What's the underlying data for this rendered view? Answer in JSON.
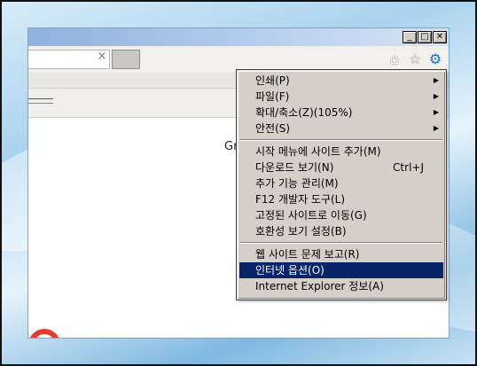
{
  "window": {
    "controls": {
      "minimize": "_",
      "restore": "□",
      "close": "✕"
    }
  },
  "addressbar": {
    "close_tab": "×"
  },
  "toolbar": {
    "home_icon": "home-icon",
    "favorites_icon": "star-icon",
    "tools_icon": "gear-icon",
    "home_glyph": "⌂",
    "star_glyph": "☆",
    "gear_glyph": "⚙"
  },
  "content": {
    "partial_text": "Gr"
  },
  "tools_menu": {
    "group1": [
      {
        "label": "인쇄(P)",
        "submenu": "▶"
      },
      {
        "label": "파일(F)",
        "submenu": "▶"
      },
      {
        "label": "확대/축소(Z)(105%)",
        "submenu": "▶"
      },
      {
        "label": "안전(S)",
        "submenu": "▶"
      }
    ],
    "group2": [
      {
        "label": "시작 메뉴에 사이트 추가(M)",
        "shortcut": ""
      },
      {
        "label": "다운로드 보기(N)",
        "shortcut": "Ctrl+J"
      },
      {
        "label": "추가 기능 관리(M)",
        "shortcut": ""
      },
      {
        "label": "F12 개발자 도구(L)",
        "shortcut": ""
      },
      {
        "label": "고정된 사이트로 이동(G)",
        "shortcut": ""
      },
      {
        "label": "호환성 보기 설정(B)",
        "shortcut": ""
      }
    ],
    "group3": [
      {
        "label": "웹 사이트 문제 보고(R)"
      },
      {
        "label": "인터넷 옵션(O)",
        "selected": true
      },
      {
        "label": "Internet Explorer 정보(A)"
      }
    ]
  },
  "colors": {
    "selection": "#0a246a",
    "menu_background": "#d4d0c8",
    "gear_blue": "#1d6fbf"
  }
}
